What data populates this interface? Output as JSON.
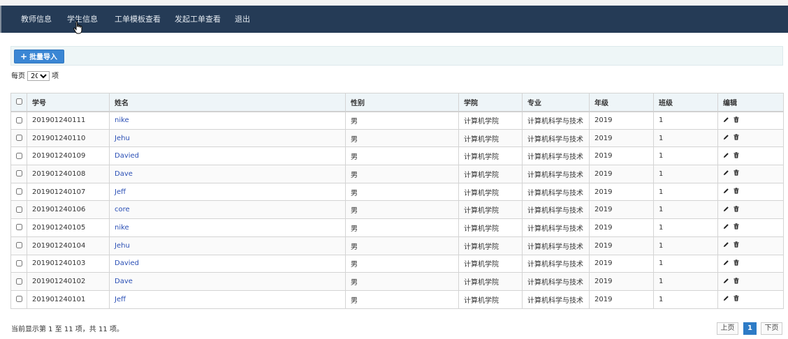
{
  "nav": {
    "items": [
      {
        "label": "教师信息"
      },
      {
        "label": "学生信息"
      },
      {
        "label": "工单模板查看"
      },
      {
        "label": "发起工单查看"
      },
      {
        "label": "退出"
      }
    ]
  },
  "toolbar": {
    "import_label": "批量导入",
    "import_icon": "plus-icon"
  },
  "pagesize": {
    "prefix": "每页",
    "selected": "20",
    "suffix": "项"
  },
  "table": {
    "headers": {
      "id": "学号",
      "name": "姓名",
      "gender": "性别",
      "college": "学院",
      "major": "专业",
      "grade": "年级",
      "class": "班级",
      "edit": "编辑"
    },
    "rows": [
      {
        "id": "201901240111",
        "name": "nike",
        "gender": "男",
        "college": "计算机学院",
        "major": "计算机科学与技术",
        "grade": "2019",
        "class": "1"
      },
      {
        "id": "201901240110",
        "name": "Jehu",
        "gender": "男",
        "college": "计算机学院",
        "major": "计算机科学与技术",
        "grade": "2019",
        "class": "1"
      },
      {
        "id": "201901240109",
        "name": "Davied",
        "gender": "男",
        "college": "计算机学院",
        "major": "计算机科学与技术",
        "grade": "2019",
        "class": "1"
      },
      {
        "id": "201901240108",
        "name": "Dave",
        "gender": "男",
        "college": "计算机学院",
        "major": "计算机科学与技术",
        "grade": "2019",
        "class": "1"
      },
      {
        "id": "201901240107",
        "name": "Jeff",
        "gender": "男",
        "college": "计算机学院",
        "major": "计算机科学与技术",
        "grade": "2019",
        "class": "1"
      },
      {
        "id": "201901240106",
        "name": "core",
        "gender": "男",
        "college": "计算机学院",
        "major": "计算机科学与技术",
        "grade": "2019",
        "class": "1"
      },
      {
        "id": "201901240105",
        "name": "nike",
        "gender": "男",
        "college": "计算机学院",
        "major": "计算机科学与技术",
        "grade": "2019",
        "class": "1"
      },
      {
        "id": "201901240104",
        "name": "Jehu",
        "gender": "男",
        "college": "计算机学院",
        "major": "计算机科学与技术",
        "grade": "2019",
        "class": "1"
      },
      {
        "id": "201901240103",
        "name": "Davied",
        "gender": "男",
        "college": "计算机学院",
        "major": "计算机科学与技术",
        "grade": "2019",
        "class": "1"
      },
      {
        "id": "201901240102",
        "name": "Dave",
        "gender": "男",
        "college": "计算机学院",
        "major": "计算机科学与技术",
        "grade": "2019",
        "class": "1"
      },
      {
        "id": "201901240101",
        "name": "Jeff",
        "gender": "男",
        "college": "计算机学院",
        "major": "计算机科学与技术",
        "grade": "2019",
        "class": "1"
      }
    ]
  },
  "footer": {
    "info": "当前显示第 1 至 11 项，共 11 项。",
    "prev_label": "上页",
    "current_page": "1",
    "next_label": "下页"
  },
  "colors": {
    "navbar": "#253b56",
    "primary": "#3a86d4",
    "link": "#2a4fb5",
    "active_page": "#2d7bc6"
  }
}
